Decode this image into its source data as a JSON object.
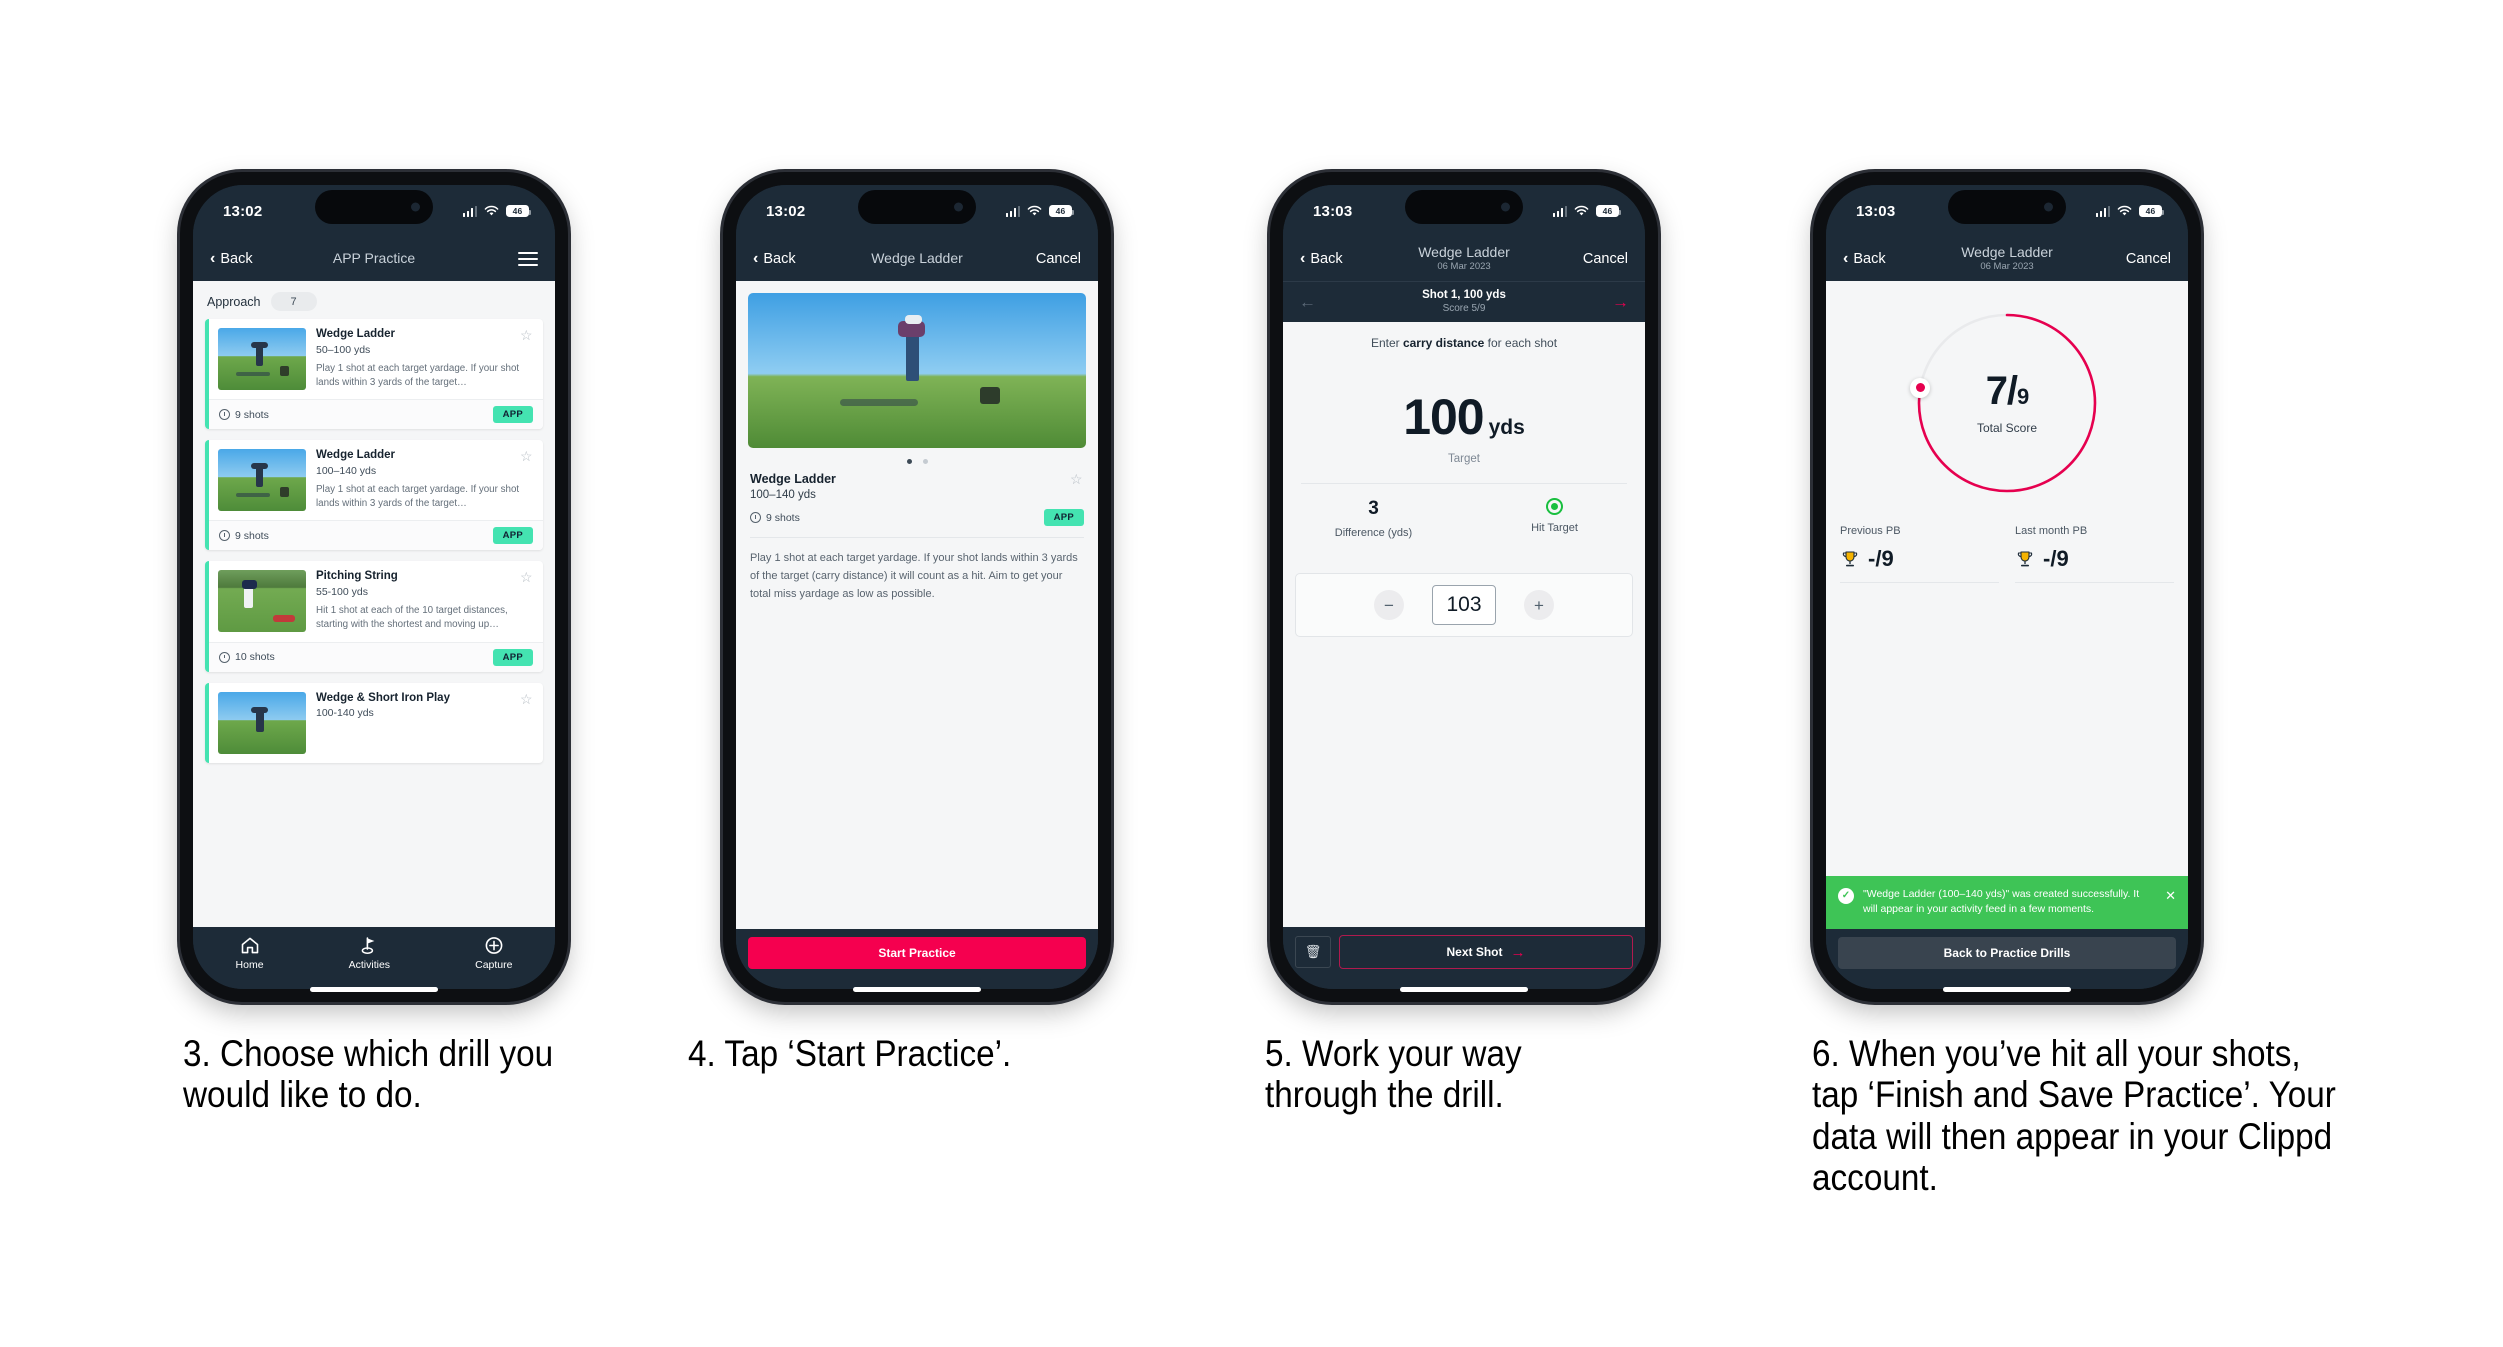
{
  "colors": {
    "nav_dark": "#1d2b38",
    "accent_green": "#44e3b1",
    "accent_pink": "#f5004f",
    "toast_green": "#3ec456",
    "ring_pink": "#e6004f",
    "hit_green": "#19bf3f",
    "trophy_gold": "#f5b301"
  },
  "phones": [
    {
      "status": {
        "time": "13:02",
        "battery": "46"
      },
      "nav": {
        "back": "Back",
        "title": "APP Practice",
        "menu_icon": "hamburger-icon"
      },
      "section": {
        "label": "Approach",
        "count": "7"
      },
      "cards": [
        {
          "title": "Wedge Ladder",
          "yardage": "50–100 yds",
          "desc": "Play 1 shot at each target yardage. If your shot lands within 3 yards of the target…",
          "shots": "9 shots",
          "badge": "APP"
        },
        {
          "title": "Wedge Ladder",
          "yardage": "100–140 yds",
          "desc": "Play 1 shot at each target yardage. If your shot lands within 3 yards of the target…",
          "shots": "9 shots",
          "badge": "APP"
        },
        {
          "title": "Pitching String",
          "yardage": "55-100 yds",
          "desc": "Hit 1 shot at each of the 10 target distances, starting with the shortest and moving up…",
          "shots": "10 shots",
          "badge": "APP"
        },
        {
          "title": "Wedge & Short Iron Play",
          "yardage": "100-140 yds",
          "desc": "",
          "shots": "",
          "badge": ""
        }
      ],
      "tabs": [
        {
          "label": "Home",
          "icon": "home-icon"
        },
        {
          "label": "Activities",
          "icon": "golf-flag-icon"
        },
        {
          "label": "Capture",
          "icon": "plus-circle-icon"
        }
      ]
    },
    {
      "status": {
        "time": "13:02",
        "battery": "46"
      },
      "nav": {
        "back": "Back",
        "title": "Wedge Ladder",
        "cancel": "Cancel"
      },
      "detail": {
        "title": "Wedge Ladder",
        "yardage": "100–140 yds",
        "shots": "9 shots",
        "badge": "APP",
        "body": "Play 1 shot at each target yardage. If your shot lands within 3 yards of the target (carry distance) it will count as a hit. Aim to get your total miss yardage as low as possible."
      },
      "cta": "Start Practice"
    },
    {
      "status": {
        "time": "13:03",
        "battery": "46"
      },
      "nav": {
        "back": "Back",
        "title": "Wedge Ladder",
        "subtitle": "06 Mar 2023",
        "cancel": "Cancel"
      },
      "subnav": {
        "shot": "Shot 1, 100 yds",
        "score": "Score 5/9"
      },
      "entry": {
        "hint_pre": "Enter ",
        "hint_bold": "carry distance",
        "hint_post": " for each shot",
        "target_value": "100",
        "target_unit": "yds",
        "target_caption": "Target",
        "difference_value": "3",
        "difference_label": "Difference (yds)",
        "hit_label": "Hit Target",
        "stepper_value": "103",
        "minus": "−",
        "plus": "+"
      },
      "cta": "Next Shot"
    },
    {
      "status": {
        "time": "13:03",
        "battery": "46"
      },
      "nav": {
        "back": "Back",
        "title": "Wedge Ladder",
        "subtitle": "06 Mar 2023",
        "cancel": "Cancel"
      },
      "summary": {
        "score_num": "7/",
        "score_den": "9",
        "score_label": "Total Score",
        "ring_fraction": 0.7778,
        "pbs": [
          {
            "label": "Previous PB",
            "value": "-/9"
          },
          {
            "label": "Last month PB",
            "value": "-/9"
          }
        ],
        "toast": "\"Wedge Ladder (100–140 yds)\" was created successfully. It will appear in your activity feed in a few moments."
      },
      "cta": "Back to Practice Drills"
    }
  ],
  "captions": [
    "3. Choose which drill you would like to do.",
    "4. Tap ‘Start Practice’.",
    "5. Work your way through the drill.",
    "6. When you’ve hit all your shots, tap ‘Finish and Save Practice’. Your data will then appear in your Clippd account."
  ]
}
